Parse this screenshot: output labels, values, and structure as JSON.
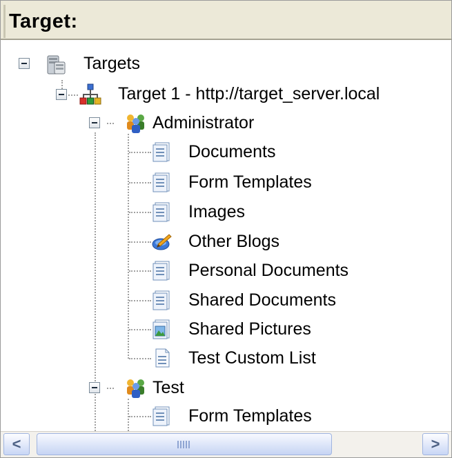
{
  "header": {
    "title": "Target:"
  },
  "tree": {
    "root": {
      "label": "Targets",
      "icon": "server-stack-icon"
    },
    "target": {
      "label": "Target 1 - http://target_server.local",
      "icon": "network-icon"
    },
    "groups": [
      {
        "label": "Administrator",
        "icon": "users-group-icon",
        "items": [
          {
            "label": "Documents",
            "icon": "document-library-icon"
          },
          {
            "label": "Form Templates",
            "icon": "document-library-icon"
          },
          {
            "label": "Images",
            "icon": "document-library-icon"
          },
          {
            "label": "Other Blogs",
            "icon": "blog-icon"
          },
          {
            "label": "Personal Documents",
            "icon": "document-library-icon"
          },
          {
            "label": "Shared Documents",
            "icon": "document-library-icon"
          },
          {
            "label": "Shared Pictures",
            "icon": "picture-library-icon"
          },
          {
            "label": "Test Custom List",
            "icon": "custom-list-icon"
          }
        ]
      },
      {
        "label": "Test",
        "icon": "users-group-icon",
        "items": [
          {
            "label": "Form Templates",
            "icon": "document-library-icon"
          }
        ]
      }
    ]
  },
  "scrollbar": {
    "left_glyph": "<",
    "right_glyph": ">",
    "colors": {
      "track": "#f3f1ec",
      "thumb": "#c6d4f3",
      "border": "#9fb4e0"
    }
  }
}
